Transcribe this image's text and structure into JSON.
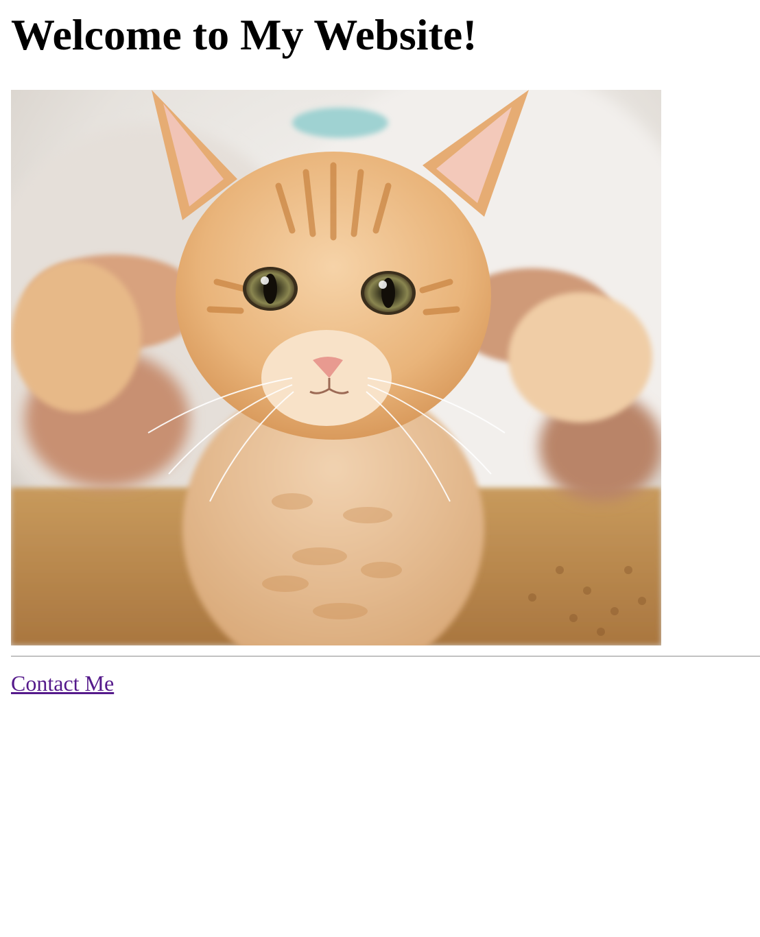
{
  "page": {
    "title": "Welcome to My Website!",
    "image": {
      "icon": "kitten-photo-icon",
      "subject": "orange tabby kitten held up by hands"
    },
    "contact_link_label": "Contact Me",
    "colors": {
      "background": "#ffffff",
      "heading": "#000000",
      "visited_link": "#551a8b",
      "divider": "#9a9a9a"
    }
  }
}
